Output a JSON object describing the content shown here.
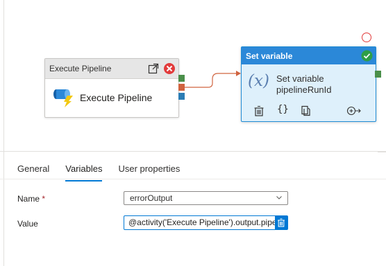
{
  "canvas": {
    "execute_pipeline": {
      "header_title": "Execute Pipeline",
      "body_label": "Execute Pipeline",
      "port_colors": {
        "success": "#4a8f4a",
        "failure": "#d0633f",
        "completion": "#2b7db5"
      }
    },
    "set_variable": {
      "header_title": "Set variable",
      "label_line1": "Set variable",
      "label_line2": "pipelineRunId",
      "icon_text": "(x)",
      "braces_text": "{}",
      "header_color": "#2b88d8"
    }
  },
  "tabs": [
    {
      "label": "General",
      "active": false
    },
    {
      "label": "Variables",
      "active": true
    },
    {
      "label": "User properties",
      "active": false
    }
  ],
  "form": {
    "name_label": "Name",
    "required_marker": "*",
    "name_value": "errorOutput",
    "value_label": "Value",
    "value_text": "@activity('Execute Pipeline').output.pipelineRunId"
  },
  "colors": {
    "accent": "#0078d4",
    "error": "#e23b3b",
    "success": "#2e9e46"
  }
}
